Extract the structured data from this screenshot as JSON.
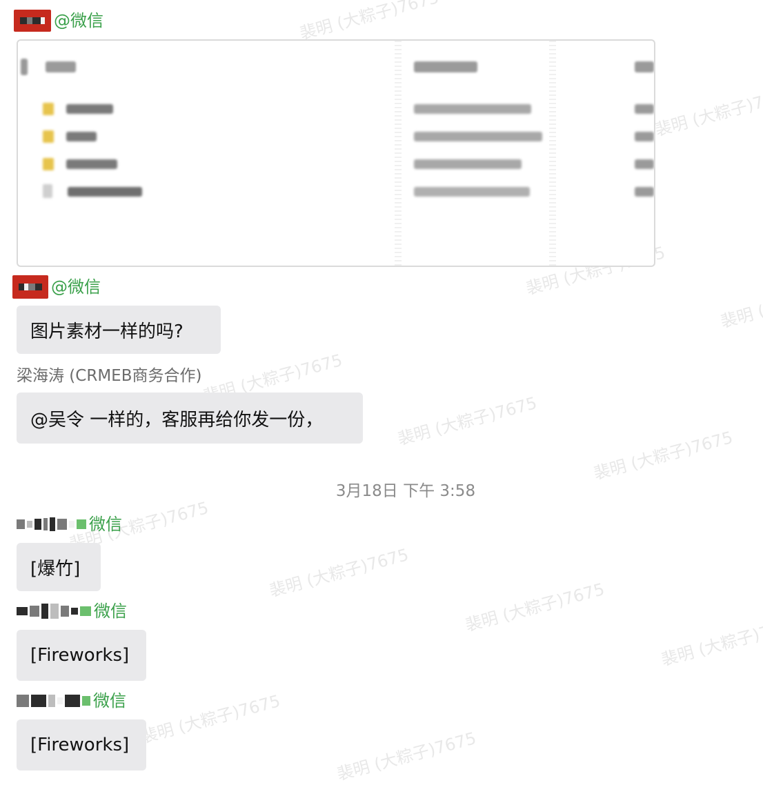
{
  "messages": [
    {
      "sender_suffix": "@微信",
      "sender_redacted": true,
      "type": "image",
      "image": {
        "rows_count": 4
      }
    },
    {
      "sender_suffix": "@微信",
      "sender_redacted": true,
      "type": "text",
      "text": "图片素材一样的吗?"
    },
    {
      "sender_name": "梁海涛 (CRMEB商务合作)",
      "type": "text",
      "text": "@吴令 一样的，客服再给你发一份，"
    },
    {
      "sender_suffix": "微信",
      "sender_redacted": true,
      "type": "text",
      "text": "[爆竹]"
    },
    {
      "sender_suffix": "微信",
      "sender_redacted": true,
      "type": "text",
      "text": "[Fireworks]"
    },
    {
      "sender_suffix": "微信",
      "sender_redacted": true,
      "type": "text",
      "text": "[Fireworks]"
    }
  ],
  "timestamp": "3月18日 下午 3:58",
  "watermark_text": "裴明 (大粽子)7675",
  "colors": {
    "wechat_green": "#3aa04a",
    "redact_red": "#c62a1e",
    "bubble_bg": "#e9e9eb",
    "folder_yellow": "#e7c44d"
  }
}
